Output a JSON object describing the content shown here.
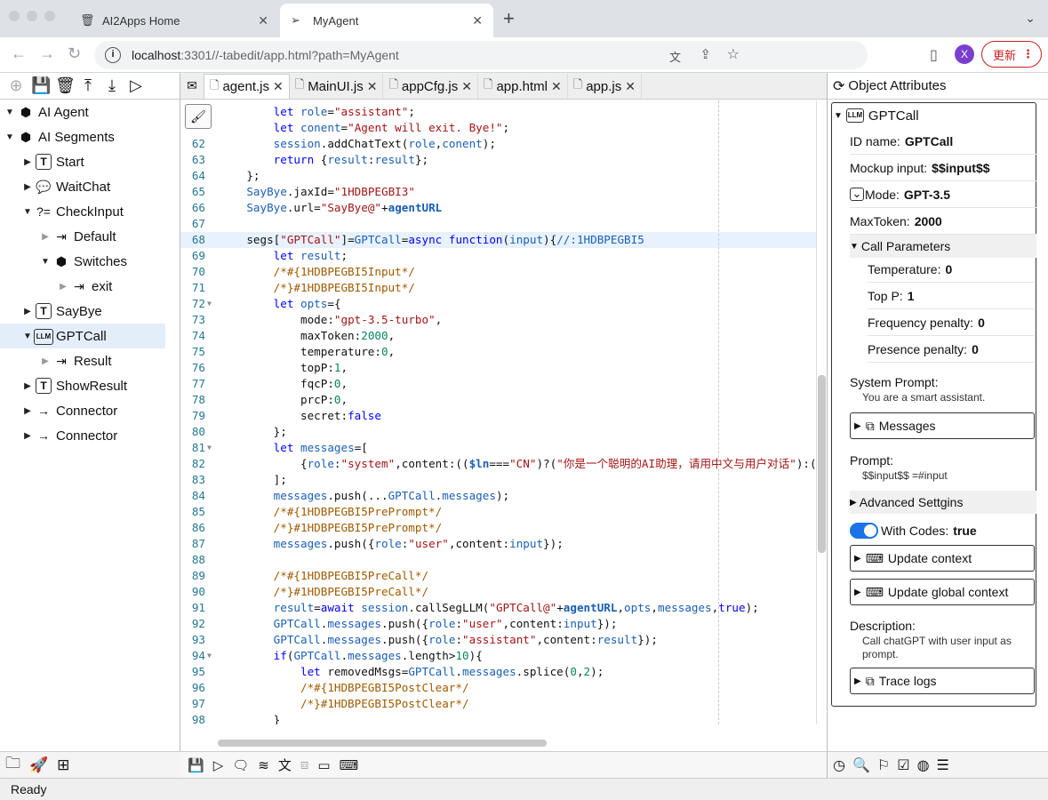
{
  "browser": {
    "tabs": [
      {
        "label": "AI2Apps Home",
        "icon": "trash-icon"
      },
      {
        "label": "MyAgent",
        "icon": "send-icon"
      }
    ],
    "url_host": "localhost",
    "url_rest": ":3301//-tabedit/app.html?path=MyAgent",
    "avatar_letter": "X",
    "update_label": "更新"
  },
  "tree": [
    {
      "label": "AI Agent",
      "icon": "cube-icon",
      "arrow": "expanded"
    },
    {
      "label": "AI Segments",
      "icon": "cubes-icon",
      "arrow": "expanded"
    },
    {
      "label": "Start",
      "icon": "text-box-icon",
      "arrow": "collapsed"
    },
    {
      "label": "WaitChat",
      "icon": "chat-icon",
      "arrow": "collapsed"
    },
    {
      "label": "CheckInput",
      "icon": "question-equals-icon",
      "arrow": "expanded"
    },
    {
      "label": "Default",
      "icon": "output-port-icon",
      "arrow": "collapsed-light"
    },
    {
      "label": "Switches",
      "icon": "cube-icon",
      "arrow": "expanded"
    },
    {
      "label": "exit",
      "icon": "output-port-icon",
      "arrow": "collapsed-light"
    },
    {
      "label": "SayBye",
      "icon": "text-box-icon",
      "arrow": "collapsed"
    },
    {
      "label": "GPTCall",
      "icon": "llm-icon",
      "arrow": "expanded"
    },
    {
      "label": "Result",
      "icon": "output-port-icon",
      "arrow": "collapsed-light"
    },
    {
      "label": "ShowResult",
      "icon": "text-box-icon",
      "arrow": "collapsed"
    },
    {
      "label": "Connector",
      "icon": "arrow-right-icon",
      "arrow": "collapsed"
    },
    {
      "label": "Connector",
      "icon": "arrow-right-icon",
      "arrow": "collapsed"
    }
  ],
  "editor_tabs": [
    {
      "label": "agent.js",
      "active": true
    },
    {
      "label": "MainUI.js",
      "active": false
    },
    {
      "label": "appCfg.js",
      "active": false
    },
    {
      "label": "app.html",
      "active": false
    },
    {
      "label": "app.js",
      "active": false
    }
  ],
  "code_lines": [
    {
      "n": "",
      "t": "        let role=\"assistant\";"
    },
    {
      "n": "",
      "t": "        let conent=\"Agent will exit. Bye!\";"
    },
    {
      "n": "62",
      "t": "        session.addChatText(role,conent);"
    },
    {
      "n": "63",
      "t": "        return {result:result};"
    },
    {
      "n": "64",
      "t": "    };"
    },
    {
      "n": "65",
      "t": "    SayBye.jaxId=\"1HDBPEGBI3\""
    },
    {
      "n": "66",
      "t": "    SayBye.url=\"SayBye@\"+agentURL"
    },
    {
      "n": "67",
      "t": ""
    },
    {
      "n": "68",
      "t": "    segs[\"GPTCall\"]=GPTCall=async function(input){//:1HDBPEGBI5"
    },
    {
      "n": "69",
      "t": "        let result;"
    },
    {
      "n": "70",
      "t": "        /*#{1HDBPEGBI5Input*/"
    },
    {
      "n": "71",
      "t": "        /*}#1HDBPEGBI5Input*/"
    },
    {
      "n": "72",
      "t": "        let opts={"
    },
    {
      "n": "73",
      "t": "            mode:\"gpt-3.5-turbo\","
    },
    {
      "n": "74",
      "t": "            maxToken:2000,"
    },
    {
      "n": "75",
      "t": "            temperature:0,"
    },
    {
      "n": "76",
      "t": "            topP:1,"
    },
    {
      "n": "77",
      "t": "            fqcP:0,"
    },
    {
      "n": "78",
      "t": "            prcP:0,"
    },
    {
      "n": "79",
      "t": "            secret:false"
    },
    {
      "n": "80",
      "t": "        };"
    },
    {
      "n": "81",
      "t": "        let messages=["
    },
    {
      "n": "82",
      "t": "            {role:\"system\",content:(($ln===\"CN\")?(\"你是一个聪明的AI助理，请用中文与用户对话\"):(\"You"
    },
    {
      "n": "83",
      "t": "        ];"
    },
    {
      "n": "84",
      "t": "        messages.push(...GPTCall.messages);"
    },
    {
      "n": "85",
      "t": "        /*#{1HDBPEGBI5PrePrompt*/"
    },
    {
      "n": "86",
      "t": "        /*}#1HDBPEGBI5PrePrompt*/"
    },
    {
      "n": "87",
      "t": "        messages.push({role:\"user\",content:input});"
    },
    {
      "n": "88",
      "t": ""
    },
    {
      "n": "89",
      "t": "        /*#{1HDBPEGBI5PreCall*/"
    },
    {
      "n": "90",
      "t": "        /*}#1HDBPEGBI5PreCall*/"
    },
    {
      "n": "91",
      "t": "        result=await session.callSegLLM(\"GPTCall@\"+agentURL,opts,messages,true);"
    },
    {
      "n": "92",
      "t": "        GPTCall.messages.push({role:\"user\",content:input});"
    },
    {
      "n": "93",
      "t": "        GPTCall.messages.push({role:\"assistant\",content:result});"
    },
    {
      "n": "94",
      "t": "        if(GPTCall.messages.length>10){"
    },
    {
      "n": "95",
      "t": "            let removedMsgs=GPTCall.messages.splice(0,2);"
    },
    {
      "n": "96",
      "t": "            /*#{1HDBPEGBI5PostClear*/"
    },
    {
      "n": "97",
      "t": "            /*}#1HDBPEGBI5PostClear*/"
    },
    {
      "n": "98",
      "t": "        }"
    },
    {
      "n": "99",
      "t": "        /*#{1HDBPEGBI5PostCall*/"
    },
    {
      "n": "100",
      "t": ""
    }
  ],
  "attributes": {
    "header": "Object Attributes",
    "object_name": "GPTCall",
    "id_label": "ID name:",
    "id_value": "GPTCall",
    "mockup_label": "Mockup input:",
    "mockup_value": "$$input$$",
    "mode_label": "Mode:",
    "mode_value": "GPT-3.5",
    "maxtoken_label": "MaxToken:",
    "maxtoken_value": "2000",
    "call_params_label": "Call Parameters",
    "temperature_label": "Temperature:",
    "temperature_value": "0",
    "topp_label": "Top P:",
    "topp_value": "1",
    "freq_label": "Frequency penalty:",
    "freq_value": "0",
    "pres_label": "Presence penalty:",
    "pres_value": "0",
    "system_prompt_label": "System Prompt:",
    "system_prompt_value": "You are a smart assistant.",
    "messages_label": "Messages",
    "prompt_label": "Prompt:",
    "prompt_value": "$$input$$ =#input",
    "advanced_label": "Advanced Settgins",
    "with_codes_label": "With Codes:",
    "with_codes_value": "true",
    "update_context_label": "Update context",
    "update_global_label": "Update global context",
    "description_label": "Description:",
    "description_value": "Call chatGPT with user input as prompt.",
    "trace_logs_label": "Trace logs"
  },
  "status": "Ready"
}
